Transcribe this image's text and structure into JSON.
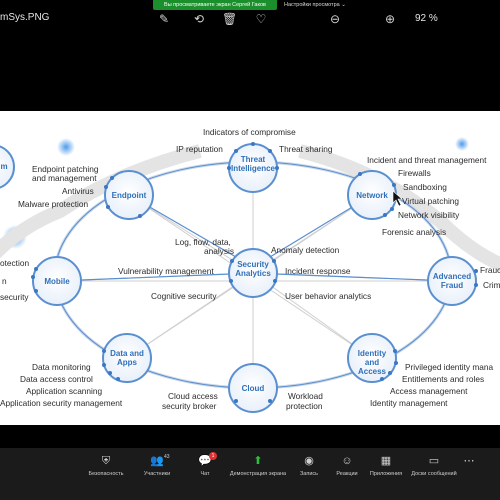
{
  "window": {
    "file_name": "mSys.PNG",
    "zoom": "92 %"
  },
  "zoom_banner": {
    "sharing_text": "Вы просматриваете экран Сергей Гаков",
    "view_settings": "Настройки просмотра"
  },
  "toolbar_icons": [
    "edit-image-icon",
    "rotate-icon",
    "delete-icon",
    "favorite-icon",
    "zoom-out-icon",
    "zoom-in-icon"
  ],
  "diagram": {
    "nodes": {
      "threat_intelligence": "Threat Intelligence",
      "endpoint": "Endpoint",
      "network": "Network",
      "mobile": "Mobile",
      "security_analytics": "Security Analytics",
      "advanced_fraud": "Advanced Fraud",
      "data_and_apps": "Data and Apps",
      "cloud": "Cloud",
      "identity_and_access": "Identity and Access",
      "left_partial": "m"
    },
    "labels": {
      "indicators_of_compromise": "Indicators of compromise",
      "ip_reputation": "IP reputation",
      "threat_sharing": "Threat sharing",
      "endpoint_patching": "Endpoint patching",
      "and_management": "and management",
      "antivirus": "Antivirus",
      "malware_protection": "Malware protection",
      "incident_threat_management": "Incident and threat management",
      "firewalls": "Firewalls",
      "sandboxing": "Sandboxing",
      "virtual_patching": "Virtual patching",
      "network_visibility": "Network visibility",
      "forensic_analysis": "Forensic analysis",
      "log_flow_data": "Log, flow, data,",
      "analysis": "analysis",
      "anomaly_detection": "Anomaly detection",
      "vulnerability_management": "Vulnerability management",
      "incident_response": "Incident response",
      "cognitive_security": "Cognitive security",
      "user_behavior_analytics": "User behavior analytics",
      "protection_partial": "otection",
      "n_partial": "n",
      "security_partial": "security",
      "fraud_partial": "Frauc",
      "crim_partial": "Crim",
      "data_monitoring": "Data monitoring",
      "data_access_control": "Data access control",
      "application_scanning": "Application scanning",
      "application_security_management": "Application security management",
      "cloud_access": "Cloud access",
      "security_broker": "security broker",
      "workload": "Workload",
      "protection": "protection",
      "privileged_identity": "Privileged identity mana",
      "entitlements_roles": "Entitlements and roles",
      "access_management": "Access management",
      "identity_management": "Identity management"
    }
  },
  "bottom_bar": {
    "security": "Безопасность",
    "participants": "Участники",
    "participants_count": "43",
    "chat": "Чат",
    "chat_badge": "1",
    "screen_share": "Демонстрация экрана",
    "record": "Запись",
    "reactions": "Реакции",
    "apps": "Приложения",
    "whiteboards": "Доски сообщений"
  }
}
